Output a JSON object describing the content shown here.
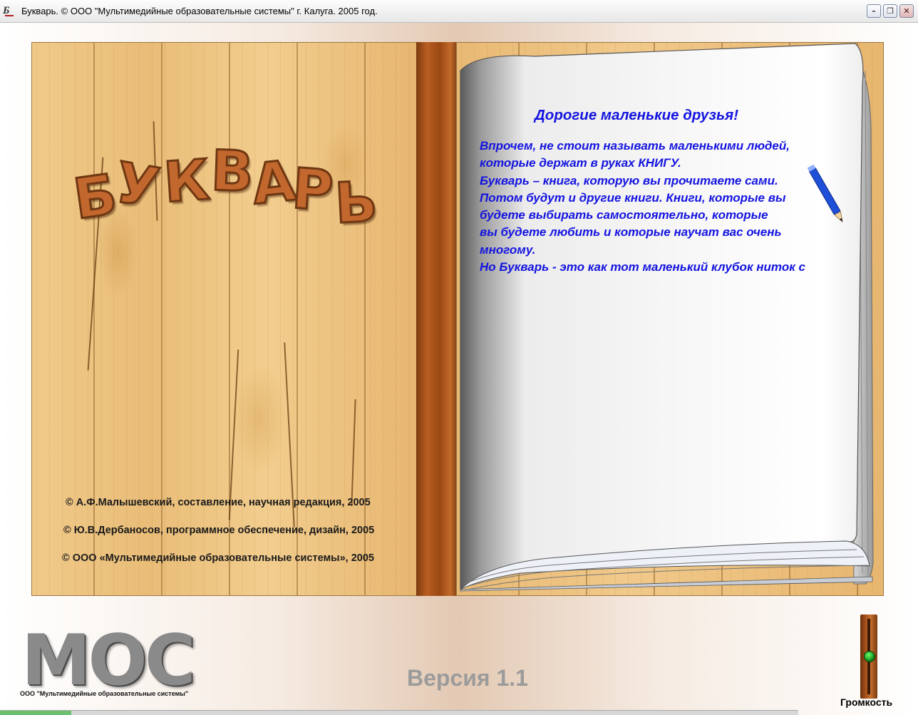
{
  "window": {
    "icon_text": "Б",
    "title": "Букварь. © ООО \"Мультимедийные образовательные системы\" г. Калуга. 2005 год.",
    "minimize": "–",
    "maximize": "❐",
    "close": "✕"
  },
  "cover": {
    "title_letters": [
      "Б",
      "У",
      "К",
      "В",
      "А",
      "Р",
      "Ь"
    ],
    "credits": [
      "© А.Ф.Малышевский, составление, научная редакция, 2005",
      "© Ю.В.Дербаносов, программное обеспечение, дизайн, 2005",
      "© ООО «Мультимедийные образовательные системы», 2005"
    ]
  },
  "page": {
    "heading": "Дорогие маленькие друзья!",
    "lines": [
      "Впрочем, не стоит называть маленькими людей,",
      "  которые держат в руках КНИГУ.",
      "     Букварь – книга, которую вы прочитаете сами.",
      "Потом будут и другие книги. Книги, которые вы",
      "будете выбирать самостоятельно,  которые",
      "вы будете любить и которые научат вас очень",
      "многому.",
      "    Но Букварь - это как тот маленький клубок ниток с"
    ],
    "pencil_color": "#1e4fd8"
  },
  "footer": {
    "logo_text": "МОС",
    "logo_caption": "ООО \"Мультимедийные образовательные системы\"",
    "version": "Версия 1.1",
    "volume_label": "Громкость",
    "volume_level": 0.5
  }
}
